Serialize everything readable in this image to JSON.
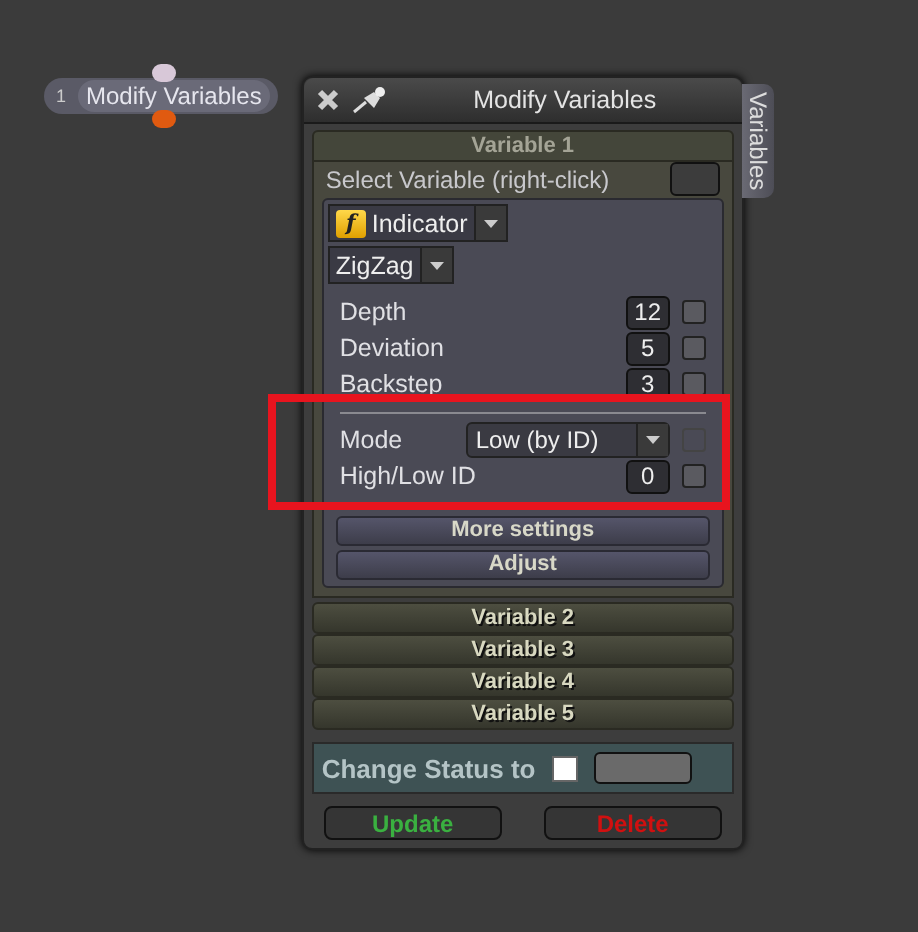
{
  "node": {
    "index": "1",
    "label": "Modify Variables"
  },
  "window": {
    "title": "Modify Variables",
    "side_tab": "Variables"
  },
  "sections": [
    {
      "title": "Variable 1",
      "expanded": true
    },
    {
      "title": "Variable 2",
      "expanded": false
    },
    {
      "title": "Variable 3",
      "expanded": false
    },
    {
      "title": "Variable 4",
      "expanded": false
    },
    {
      "title": "Variable 5",
      "expanded": false
    }
  ],
  "select_variable": {
    "label": "Select Variable (right-click)"
  },
  "type_dropdown": {
    "icon": "f",
    "value": "Indicator"
  },
  "indicator_dropdown": {
    "value": "ZigZag"
  },
  "param_groups": [
    [
      {
        "kind": "number",
        "label": "Depth",
        "value": "12",
        "checked": false,
        "disabled": false
      },
      {
        "kind": "number",
        "label": "Deviation",
        "value": "5",
        "checked": false,
        "disabled": false
      },
      {
        "kind": "number",
        "label": "Backstep",
        "value": "3",
        "checked": false,
        "disabled": false
      }
    ],
    [
      {
        "kind": "select",
        "label": "Mode",
        "value": "Low (by ID)",
        "checked": false,
        "disabled": true
      },
      {
        "kind": "number",
        "label": "High/Low ID",
        "value": "0",
        "checked": false,
        "disabled": false
      }
    ]
  ],
  "panel_buttons": [
    "More settings",
    "Adjust"
  ],
  "status": {
    "label": "Change Status to",
    "checked": false
  },
  "actions": [
    {
      "kind": "update",
      "label": "Update"
    },
    {
      "kind": "delete",
      "label": "Delete"
    }
  ]
}
